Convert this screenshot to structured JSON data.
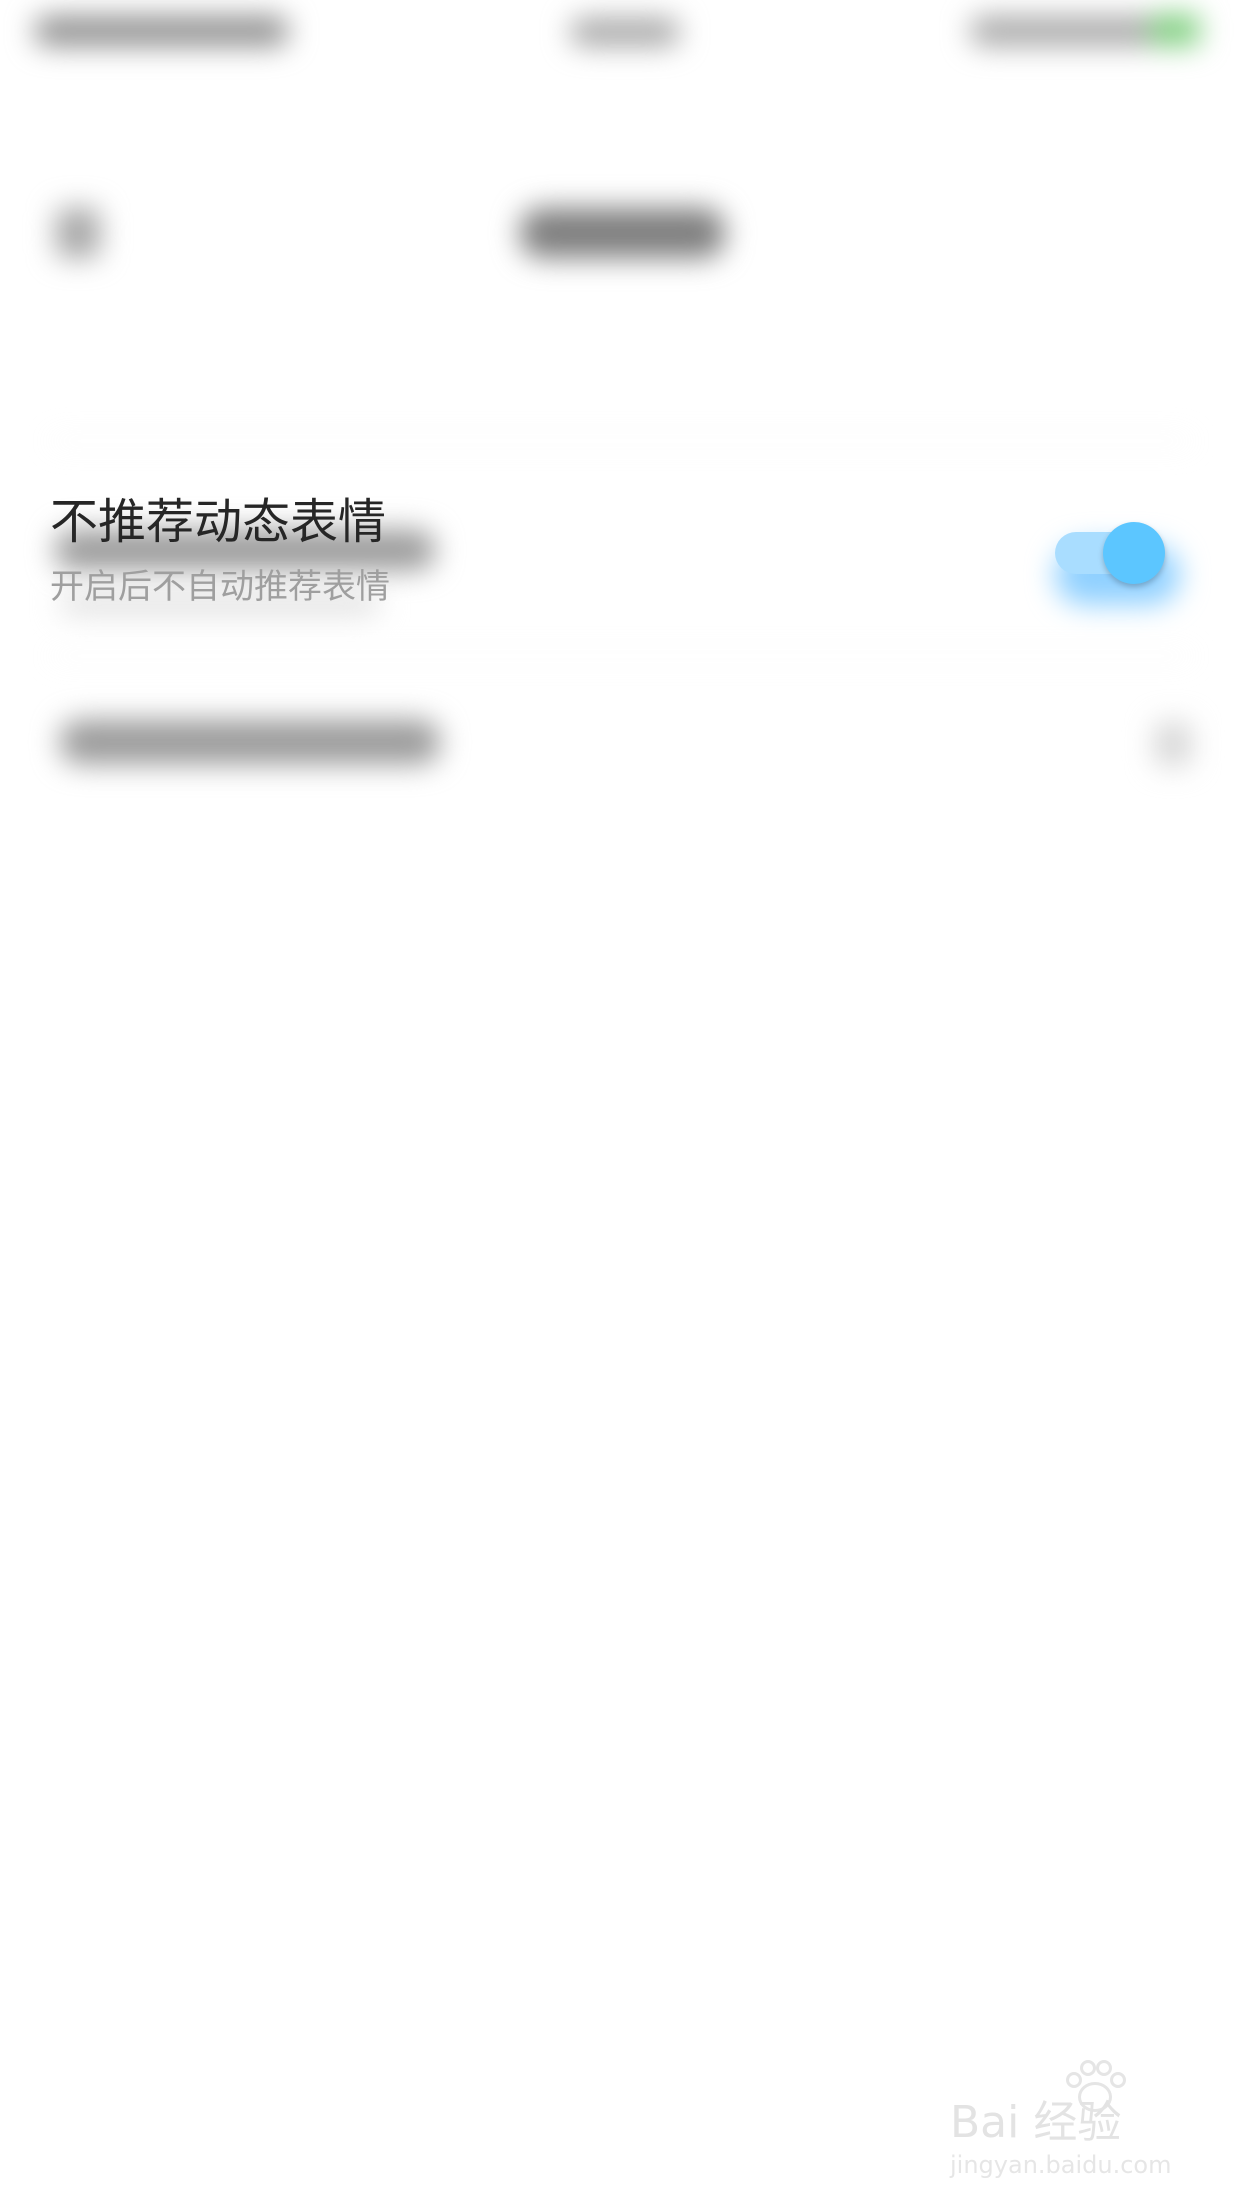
{
  "settings": {
    "items": [
      {
        "title": "不推荐动态表情",
        "subtitle": "开启后不自动推荐表情",
        "toggle_on": true
      }
    ]
  },
  "watermark": {
    "brand": "Bai 经验",
    "url": "jingyan.baidu.com"
  },
  "colors": {
    "accent": "#5CC6FF",
    "toggle_track": "#A9DDFF",
    "title_text": "#262626",
    "subtitle_text": "#9F9F9F"
  }
}
